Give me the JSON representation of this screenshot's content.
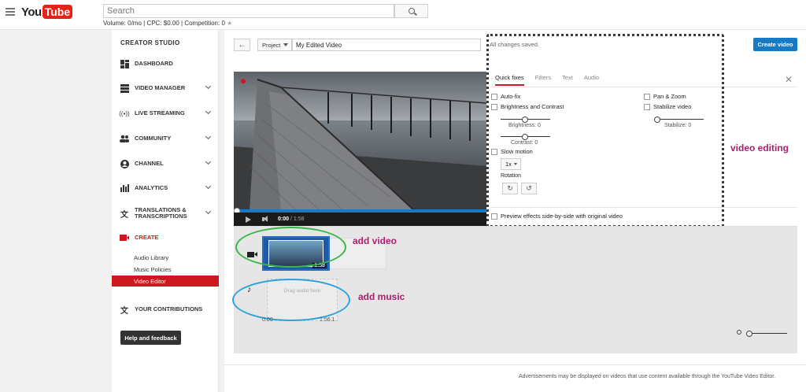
{
  "header": {
    "logo": {
      "you": "You",
      "tube": "Tube"
    },
    "search_placeholder": "Search",
    "keyword_stats": "Volume: 0/mo | CPC: $0.00 | Competition: 0"
  },
  "sidebar": {
    "title": "CREATOR STUDIO",
    "items": [
      {
        "label": "DASHBOARD",
        "icon": "dashboard-icon"
      },
      {
        "label": "VIDEO MANAGER",
        "icon": "video-manager-icon"
      },
      {
        "label": "LIVE STREAMING",
        "icon": "live-streaming-icon"
      },
      {
        "label": "COMMUNITY",
        "icon": "community-icon"
      },
      {
        "label": "CHANNEL",
        "icon": "channel-icon"
      },
      {
        "label": "ANALYTICS",
        "icon": "analytics-icon"
      },
      {
        "label_line1": "TRANSLATIONS &",
        "label_line2": "TRANSCRIPTIONS",
        "icon": "translate-icon"
      },
      {
        "label": "CREATE",
        "icon": "create-icon"
      }
    ],
    "create_subitems": [
      "Audio Library",
      "Music Policies",
      "Video Editor"
    ],
    "contributions": "YOUR CONTRIBUTIONS",
    "help_button": "Help and feedback"
  },
  "editor": {
    "project_label": "Project",
    "title_value": "My Edited Video",
    "saved_status": "All changes saved.",
    "create_button": "Create video",
    "player": {
      "current_time": "0:00",
      "duration": "/ 1:58"
    }
  },
  "panel": {
    "tabs": [
      "Quick fixes",
      "Filters",
      "Text",
      "Audio"
    ],
    "active_tab": "Quick fixes",
    "autofix": "Auto-fix",
    "brightness_contrast": "Brightness and Contrast",
    "brightness_label": "Brightness: 0",
    "contrast_label": "Contrast: 0",
    "slow_motion": "Slow motion",
    "rate": "1x",
    "rotation": "Rotation",
    "pan_zoom": "Pan & Zoom",
    "stabilize": "Stabilize video",
    "stabilize_label": "Stabilize: 0",
    "preview_side": "Preview effects side-by-side with original video"
  },
  "annotations": {
    "video_editing": "video editing",
    "add_video": "add video",
    "add_music": "add music"
  },
  "timeline": {
    "clip_duration": "1:58",
    "audio_placeholder": "Drag audio here",
    "start_time": "0:00",
    "end_time": "1:56.1"
  },
  "footer": {
    "notice": "Advertisements may be displayed on videos that use content available through the YouTube Video Editor."
  },
  "colors": {
    "brand_red": "#cc181e",
    "accent_blue": "#167ac6",
    "annotation": "#a8206f",
    "video_ring": "#3cb54a",
    "music_ring": "#2ba1dd"
  }
}
